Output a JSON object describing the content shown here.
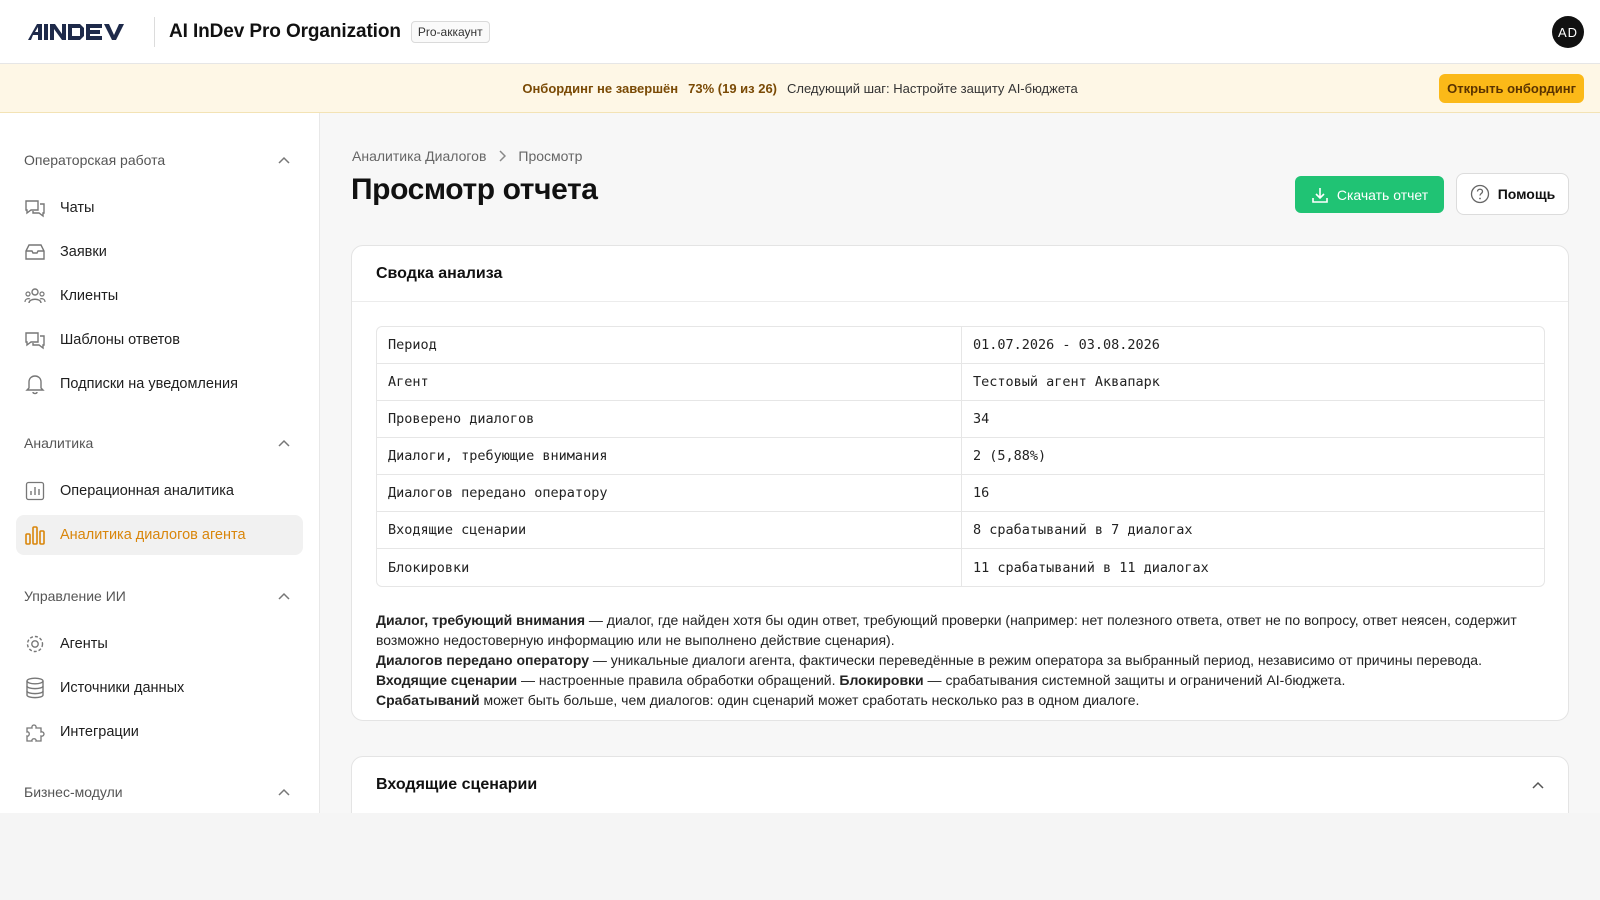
{
  "header": {
    "logo_text": "AINDEV",
    "org_name": "AI InDev Pro Organization",
    "plan_badge": "Pro-аккаунт",
    "avatar_initials": "AD"
  },
  "banner": {
    "title": "Онбординг не завершён",
    "progress": "73% (19 из 26)",
    "next_step": "Следующий шаг: Настройте защиту AI-бюджета",
    "button": "Открыть онбординг",
    "progress_fraction": 0.73,
    "accent_color": "#fbb918"
  },
  "sidebar": {
    "sections": [
      {
        "title": "Операторская работа",
        "items": [
          {
            "label": "Чаты",
            "icon": "chat-icon"
          },
          {
            "label": "Заявки",
            "icon": "inbox-icon"
          },
          {
            "label": "Клиенты",
            "icon": "users-icon"
          },
          {
            "label": "Шаблоны ответов",
            "icon": "chat-template-icon"
          },
          {
            "label": "Подписки на уведомления",
            "icon": "bell-icon"
          }
        ]
      },
      {
        "title": "Аналитика",
        "items": [
          {
            "label": "Операционная аналитика",
            "icon": "chart-icon"
          },
          {
            "label": "Аналитика диалогов агента",
            "icon": "bar-chart-icon",
            "active": true
          }
        ]
      },
      {
        "title": "Управление ИИ",
        "items": [
          {
            "label": "Агенты",
            "icon": "gear-icon"
          },
          {
            "label": "Источники данных",
            "icon": "database-icon"
          },
          {
            "label": "Интеграции",
            "icon": "puzzle-icon"
          }
        ]
      },
      {
        "title": "Бизнес-модули",
        "items": []
      }
    ],
    "active_color": "#d9860b"
  },
  "breadcrumb": {
    "parent": "Аналитика Диалогов",
    "current": "Просмотр"
  },
  "page": {
    "title": "Просмотр отчета",
    "download_button": "Скачать отчет",
    "help_button": "Помощь"
  },
  "summary": {
    "title": "Сводка анализа",
    "rows": [
      {
        "key": "Период",
        "value": "01.07.2026 - 03.08.2026"
      },
      {
        "key": "Агент",
        "value": "Тестовый агент Аквапарк"
      },
      {
        "key": "Проверено диалогов",
        "value": "34"
      },
      {
        "key": "Диалоги, требующие внимания",
        "value": "2 (5,88%)"
      },
      {
        "key": "Диалогов передано оператору",
        "value": "16"
      },
      {
        "key": "Входящие сценарии",
        "value": "8 срабатываний в 7 диалогах"
      },
      {
        "key": "Блокировки",
        "value": "11 срабатываний в 11 диалогах"
      }
    ],
    "notes": {
      "n1_term": "Диалог, требующий внимания",
      "n1_text": " — диалог, где найден хотя бы один ответ, требующий проверки (например: нет полезного ответа, ответ не по вопросу, ответ неясен, содержит возможно недостоверную информацию или не выполнено действие сценария).",
      "n2_term": "Диалогов передано оператору",
      "n2_text": " — уникальные диалоги агента, фактически переведённые в режим оператора за выбранный период, независимо от причины перевода.",
      "n3_term": "Входящие сценарии",
      "n3_text": " — настроенные правила обработки обращений. ",
      "n4_term": "Блокировки",
      "n4_text": " — срабатывания системной защиты и ограничений AI-бюджета.",
      "n5_term": "Срабатываний",
      "n5_text": " может быть больше, чем диалогов: один сценарий может сработать несколько раз в одном диалоге."
    }
  },
  "scenarios_card": {
    "title": "Входящие сценарии"
  },
  "colors": {
    "download_green": "#20c374"
  }
}
